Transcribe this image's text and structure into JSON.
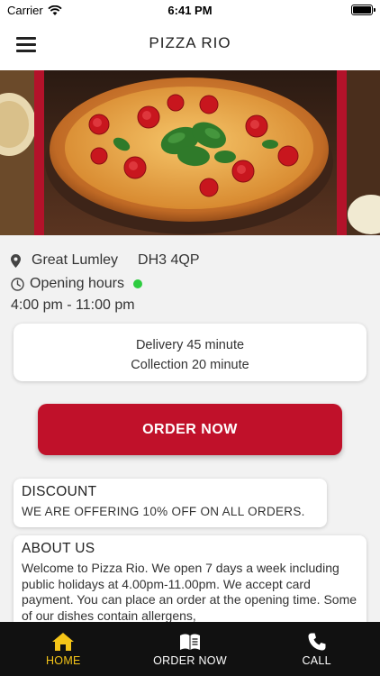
{
  "status_bar": {
    "carrier": "Carrier",
    "time": "6:41 PM"
  },
  "header": {
    "title": "PIZZA RIO"
  },
  "info": {
    "town": "Great Lumley",
    "postcode": "DH3 4QP",
    "opening_label": "Opening hours",
    "hours": "4:00 pm - 11:00 pm"
  },
  "delivery": {
    "delivery_text": "Delivery 45 minute",
    "collection_text": "Collection 20 minute"
  },
  "order_button": {
    "label": "ORDER NOW"
  },
  "discount": {
    "title": "DISCOUNT",
    "text": "WE ARE OFFERING 10% OFF ON ALL ORDERS."
  },
  "about": {
    "title": "ABOUT US",
    "text": "Welcome to Pizza Rio. We open 7 days a week including public holidays at 4.00pm-11.00pm. We accept card payment. You can place an order at the opening time. Some of our dishes contain allergens,"
  },
  "tabs": [
    {
      "label": "HOME",
      "icon": "home-icon",
      "active": true
    },
    {
      "label": "ORDER NOW",
      "icon": "menu-book-icon",
      "active": false
    },
    {
      "label": "CALL",
      "icon": "phone-icon",
      "active": false
    }
  ],
  "colors": {
    "accent": "#c0112a",
    "tab_active": "#f5c518",
    "tab_bar": "#111111",
    "open_indicator": "#2ecc40"
  }
}
